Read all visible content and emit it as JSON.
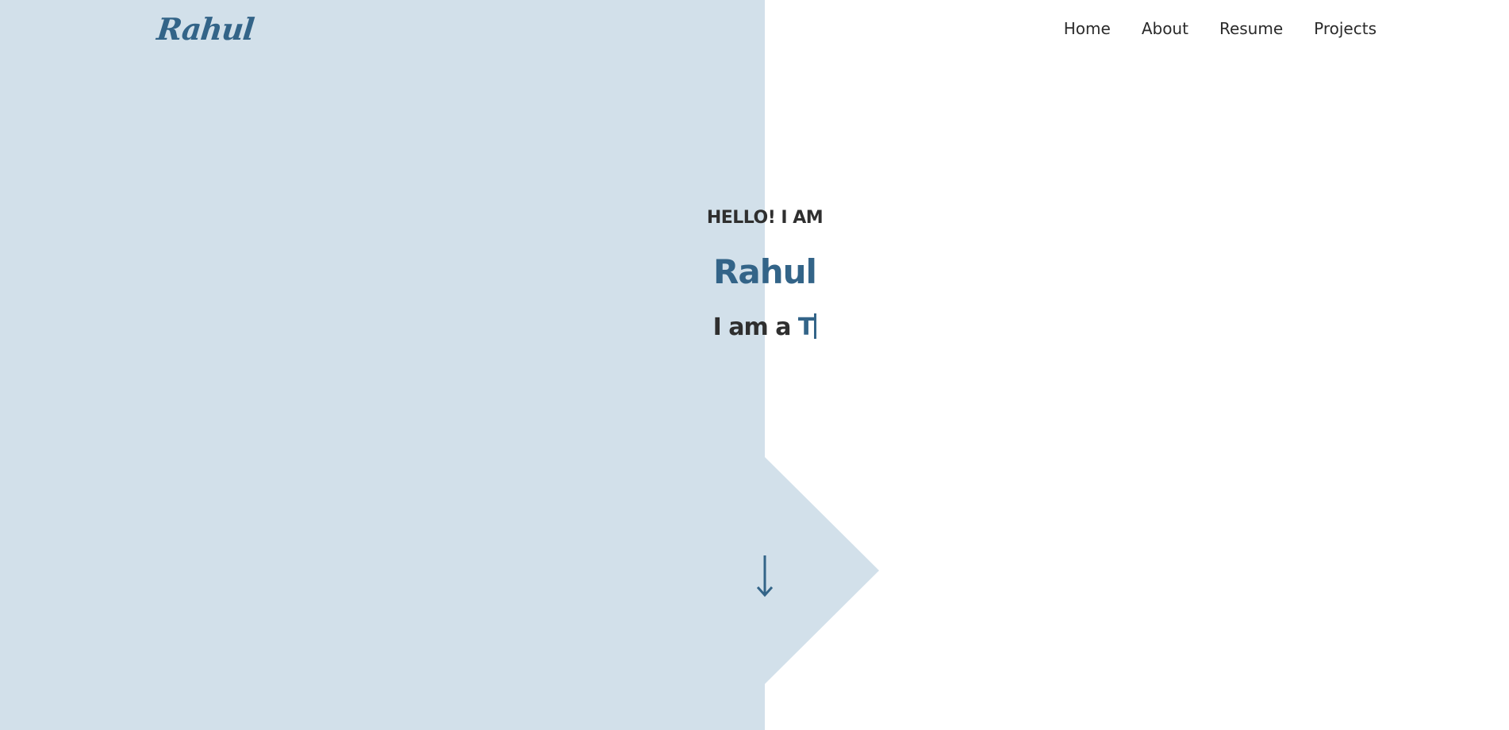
{
  "header": {
    "logo_text": "Rahul",
    "nav": [
      {
        "label": "Home"
      },
      {
        "label": "About"
      },
      {
        "label": "Resume"
      },
      {
        "label": "Projects"
      }
    ]
  },
  "hero": {
    "kicker": "HELLO! I AM",
    "name": "Rahul",
    "role_prefix": "I am a ",
    "role_typed": "T"
  },
  "icons": {
    "scroll": "arrow-down-icon"
  },
  "colors": {
    "accent": "#336488",
    "panel": "#d2e0ea",
    "text": "#2f2f2f",
    "background": "#ffffff"
  }
}
